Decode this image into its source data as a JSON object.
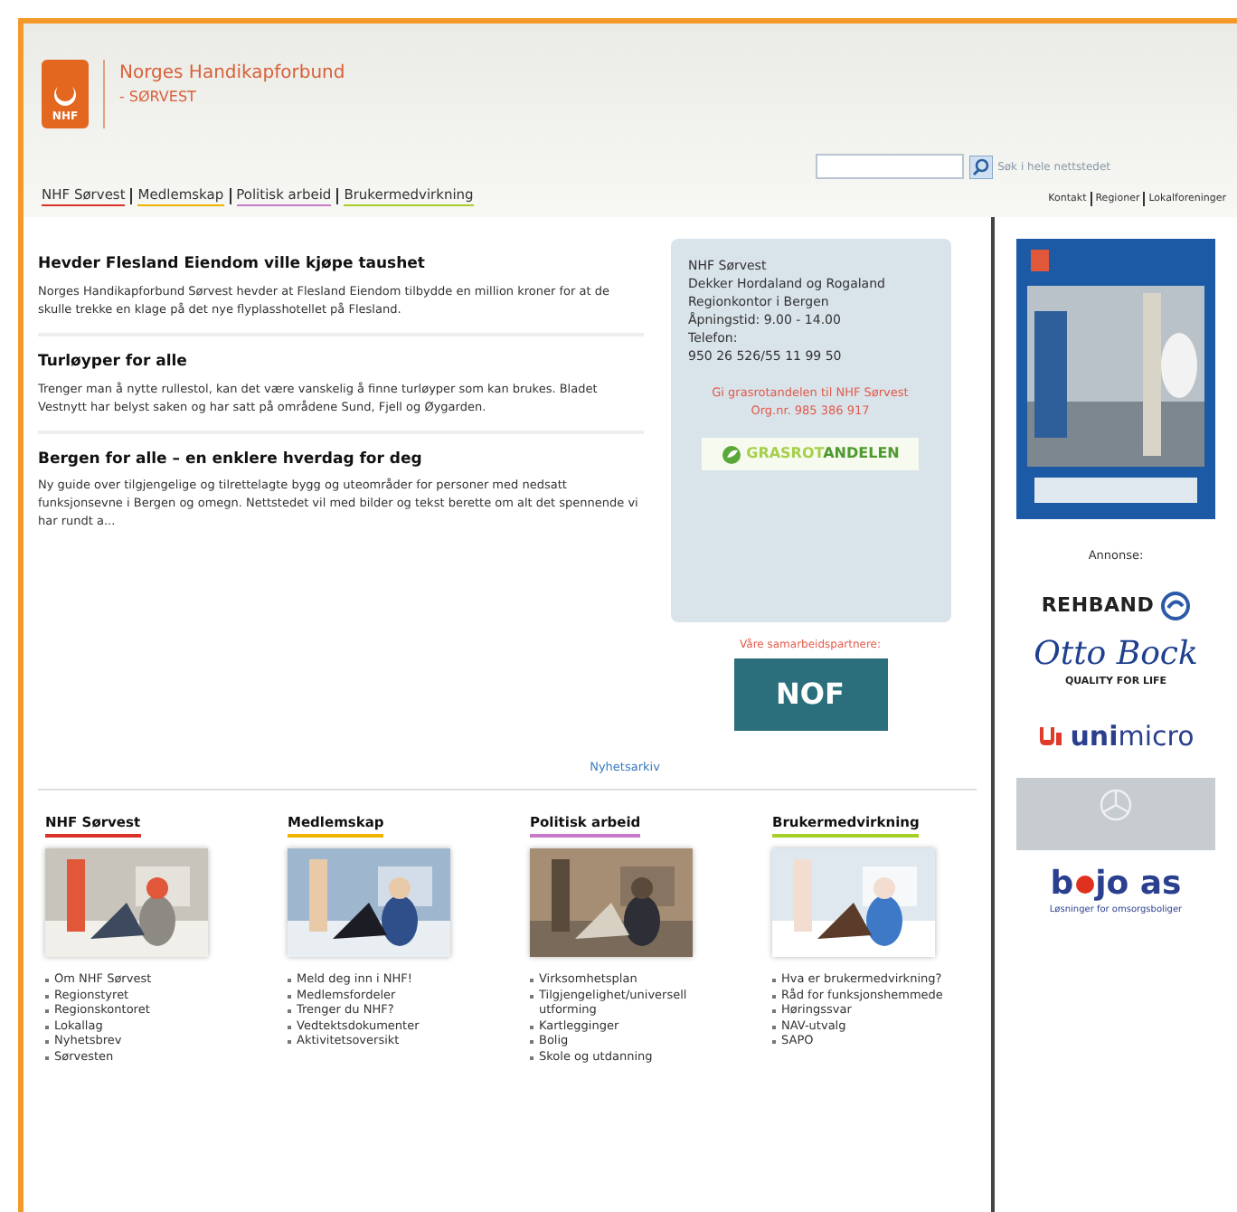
{
  "header": {
    "logo_text": "NHF",
    "title": "Norges Handikapforbund",
    "subtitle": "- SØRVEST",
    "search": {
      "button_label": "Søk i hele nettstedet"
    }
  },
  "nav": [
    {
      "label": "NHF Sørvest",
      "color": "#d9322b"
    },
    {
      "label": "Medlemskap",
      "color": "#f0b400"
    },
    {
      "label": "Politisk arbeid",
      "color": "#c77ac9"
    },
    {
      "label": "Brukermedvirkning",
      "color": "#a7cf2a"
    }
  ],
  "top_links": [
    "Kontakt",
    "Regioner",
    "Lokalforeninger"
  ],
  "news": [
    {
      "title": "Hevder Flesland Eiendom ville kjøpe taushet",
      "text": "Norges Handikapforbund Sørvest hevder at Flesland Eiendom tilbydde en million kroner for at de skulle trekke en klage på det nye flyplasshotellet på Flesland."
    },
    {
      "title": "Turløyper for alle",
      "text": "Trenger man å nytte rullestol, kan det være vanskelig å finne turløyper som kan brukes. Bladet Vestnytt har belyst saken og har satt på områdene Sund, Fjell og Øygarden."
    },
    {
      "title": "Bergen for alle – en enklere hverdag for deg",
      "text": "Ny guide over tilgjengelige og tilrettelagte bygg og uteområder for personer med nedsatt funksjonsevne i Bergen og omegn. Nettstedet vil med bilder og tekst berette om alt det spennende vi har rundt a..."
    }
  ],
  "info": {
    "lines": [
      "NHF Sørvest",
      "Dekker Hordaland og Rogaland",
      "Regionkontor i Bergen",
      "Åpningstid: 9.00 - 14.00",
      "Telefon:",
      "950 26 526/55 11 99 50"
    ],
    "notice": [
      "Gi grasrotandelen til NHF Sørvest",
      "Org.nr. 985 386 917"
    ],
    "grasrot": {
      "part1": "GRASROT",
      "part2": "ANDELEN"
    }
  },
  "partners": {
    "label": "Våre samarbeidspartnere:",
    "logo_text": "NOF"
  },
  "archive_link": "Nyhetsarkiv",
  "sections": [
    {
      "title": "NHF Sørvest",
      "color": "#d9322b",
      "links": [
        "Om NHF Sørvest",
        "Regionstyret",
        "Regionskontoret",
        "Lokallag",
        "Nyhetsbrev",
        "Sørvesten"
      ]
    },
    {
      "title": "Medlemskap",
      "color": "#f0b400",
      "links": [
        "Meld deg inn i NHF!",
        "Medlemsfordeler",
        "Trenger du NHF?",
        "Vedtektsdokumenter",
        "Aktivitetsoversikt"
      ]
    },
    {
      "title": "Politisk arbeid",
      "color": "#c77ac9",
      "links": [
        "Virksomhetsplan",
        "Tilgjengelighet/universell utforming",
        "Kartlegginger",
        "Bolig",
        "Skole og utdanning"
      ]
    },
    {
      "title": "Brukermedvirkning",
      "color": "#a7cf2a",
      "links": [
        "Hva er brukermedvirkning?",
        "Råd for funksjonshemmede",
        "Høringssvar",
        "NAV-utvalg",
        "SAPO"
      ]
    }
  ],
  "ads": {
    "label": "Annonse:",
    "rehband": "REHBAND",
    "ottobock": "Otto Bock",
    "ottobock_tagline": "QUALITY FOR LIFE",
    "unimicro_bold": "uni",
    "unimicro_light": "micro",
    "bojo": {
      "part1": "b",
      "part2": "jo as",
      "tagline": "Løsninger for omsorgsboliger"
    }
  }
}
